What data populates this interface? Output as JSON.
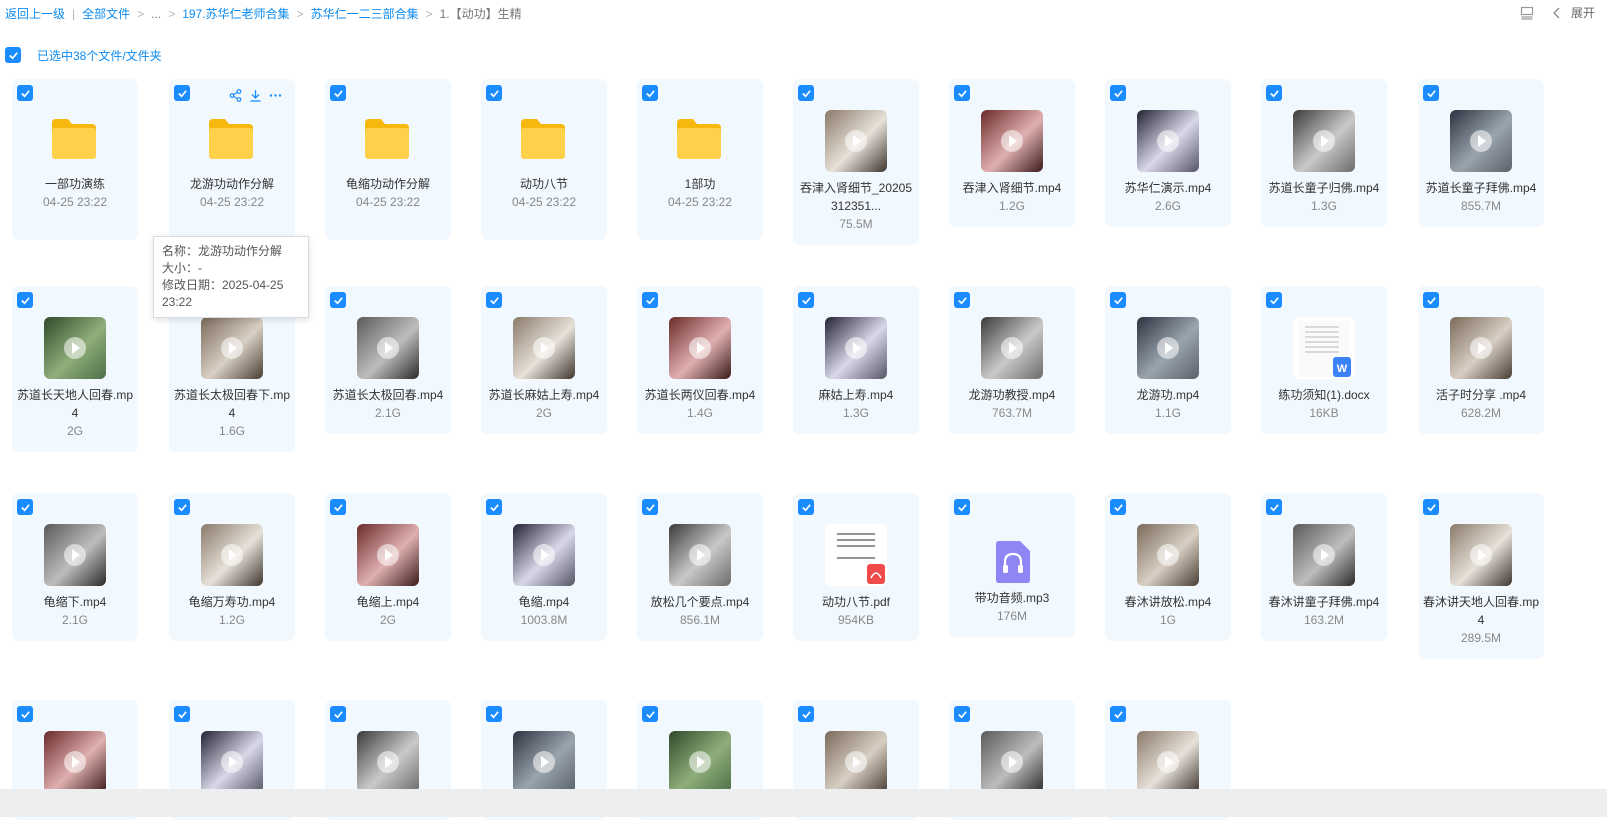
{
  "breadcrumb": {
    "back": "返回上一级",
    "all_files": "全部文件",
    "ellipsis": "...",
    "level1": "197.苏华仁老师合集",
    "level2": "苏华仁一二三部合集",
    "current": "1.【动功】生精"
  },
  "top_right": {
    "expand_label": "展开",
    "list_icon": "list-view-icon",
    "chevron_icon": "chevron-left-icon"
  },
  "selection": {
    "text": "已选中38个文件/文件夹"
  },
  "tooltip": {
    "name": "名称：龙游功动作分解",
    "size": "大小：-",
    "modified": "修改日期：2025-04-25 23:22"
  },
  "accent_color": "#1a8cff",
  "files": [
    {
      "name": "一部功演练",
      "meta": "04-25 23:22",
      "type": "folder"
    },
    {
      "name": "龙游功动作分解",
      "meta": "04-25 23:22",
      "type": "folder"
    },
    {
      "name": "龟缩功动作分解",
      "meta": "04-25 23:22",
      "type": "folder"
    },
    {
      "name": "动功八节",
      "meta": "04-25 23:22",
      "type": "folder"
    },
    {
      "name": "1部功",
      "meta": "04-25 23:22",
      "type": "folder"
    },
    {
      "name": "吞津入肾细节_20205312351...",
      "meta": "75.5M",
      "type": "video"
    },
    {
      "name": "吞津入肾细节.mp4",
      "meta": "1.2G",
      "type": "video"
    },
    {
      "name": "苏华仁演示.mp4",
      "meta": "2.6G",
      "type": "video"
    },
    {
      "name": "苏道长童子归佛.mp4",
      "meta": "1.3G",
      "type": "video"
    },
    {
      "name": "苏道长童子拜佛.mp4",
      "meta": "855.7M",
      "type": "video"
    },
    {
      "name": "苏道长天地人回春.mp4",
      "meta": "2G",
      "type": "video"
    },
    {
      "name": "苏道长太极回春下.mp4",
      "meta": "1.6G",
      "type": "video"
    },
    {
      "name": "苏道长太极回春.mp4",
      "meta": "2.1G",
      "type": "video"
    },
    {
      "name": "苏道长麻姑上寿.mp4",
      "meta": "2G",
      "type": "video"
    },
    {
      "name": "苏道长两仪回春.mp4",
      "meta": "1.4G",
      "type": "video"
    },
    {
      "name": "麻姑上寿.mp4",
      "meta": "1.3G",
      "type": "video"
    },
    {
      "name": "龙游功教授.mp4",
      "meta": "763.7M",
      "type": "video"
    },
    {
      "name": "龙游功.mp4",
      "meta": "1.1G",
      "type": "video"
    },
    {
      "name": "练功须知(1).docx",
      "meta": "16KB",
      "type": "doc"
    },
    {
      "name": "活子时分享 .mp4",
      "meta": "628.2M",
      "type": "video"
    },
    {
      "name": "龟缩下.mp4",
      "meta": "2.1G",
      "type": "video"
    },
    {
      "name": "龟缩万寿功.mp4",
      "meta": "1.2G",
      "type": "video"
    },
    {
      "name": "龟缩上.mp4",
      "meta": "2G",
      "type": "video"
    },
    {
      "name": "龟缩.mp4",
      "meta": "1003.8M",
      "type": "video"
    },
    {
      "name": "放松几个要点.mp4",
      "meta": "856.1M",
      "type": "video"
    },
    {
      "name": "动功八节.pdf",
      "meta": "954KB",
      "type": "pdf"
    },
    {
      "name": "带功音频.mp3",
      "meta": "176M",
      "type": "audio"
    },
    {
      "name": "春沐讲放松.mp4",
      "meta": "1G",
      "type": "video"
    },
    {
      "name": "春沐讲童子拜佛.mp4",
      "meta": "163.2M",
      "type": "video"
    },
    {
      "name": "春沐讲天地人回春.mp4",
      "meta": "289.5M",
      "type": "video"
    },
    {
      "name": "",
      "meta": "",
      "type": "video"
    },
    {
      "name": "",
      "meta": "",
      "type": "video"
    },
    {
      "name": "",
      "meta": "",
      "type": "video"
    },
    {
      "name": "",
      "meta": "",
      "type": "video"
    },
    {
      "name": "",
      "meta": "",
      "type": "video"
    },
    {
      "name": "",
      "meta": "",
      "type": "video"
    },
    {
      "name": "",
      "meta": "",
      "type": "video"
    },
    {
      "name": "",
      "meta": "",
      "type": "video"
    }
  ]
}
